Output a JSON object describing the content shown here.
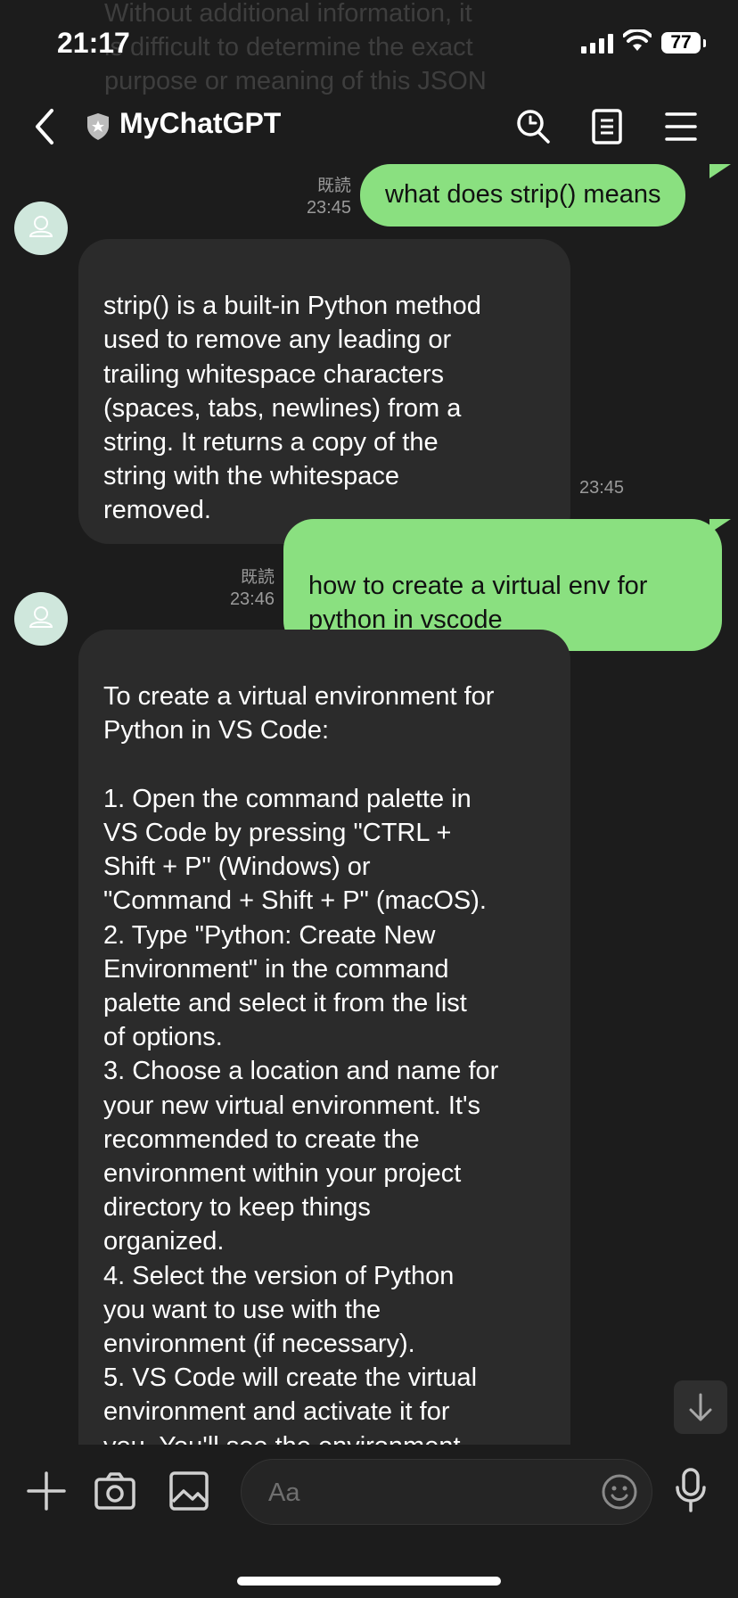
{
  "status_bar": {
    "time": "21:17",
    "battery": "77"
  },
  "background_text": "Without additional information, it\nis difficult to determine the exact\npurpose or meaning of this JSON",
  "header": {
    "title": "MyChatGPT"
  },
  "messages": [
    {
      "role": "user",
      "text": "what does strip() means",
      "read": "既読",
      "time": "23:45"
    },
    {
      "role": "bot",
      "text": "strip() is a built-in Python method\nused to remove any leading or\ntrailing whitespace characters\n(spaces, tabs, newlines) from a\nstring. It returns a copy of the\nstring with the whitespace\nremoved.",
      "time": "23:45"
    },
    {
      "role": "user",
      "text": "how to create a virtual env for\npython in vscode",
      "read": "既読",
      "time": "23:46"
    },
    {
      "role": "bot",
      "text": "To create a virtual environment for\nPython in VS Code:\n\n1. Open the command palette in\nVS Code by pressing \"CTRL +\nShift + P\" (Windows) or\n\"Command + Shift + P\" (macOS).\n2. Type \"Python: Create New\nEnvironment\" in the command\npalette and select it from the list\nof options.\n3. Choose a location and name for\nyour new virtual environment. It's\nrecommended to create the\nenvironment within your project\ndirectory to keep things\norganized.\n4. Select the version of Python\nyou want to use with the\nenvironment (if necessary).\n5. VS Code will create the virtual\nenvironment and activate it for\nyou. You'll see the environment\nname in the bottom left corner of"
    }
  ],
  "input": {
    "placeholder": "Aa"
  },
  "colors": {
    "user_bubble": "#8ae080",
    "bot_bubble": "#2b2b2b",
    "background": "#1c1c1c"
  },
  "icons": [
    "back-icon",
    "shield-icon",
    "search-icon",
    "notes-icon",
    "menu-icon",
    "avatar-icon",
    "plus-icon",
    "camera-icon",
    "image-icon",
    "emoji-icon",
    "mic-icon",
    "arrow-down-icon"
  ]
}
